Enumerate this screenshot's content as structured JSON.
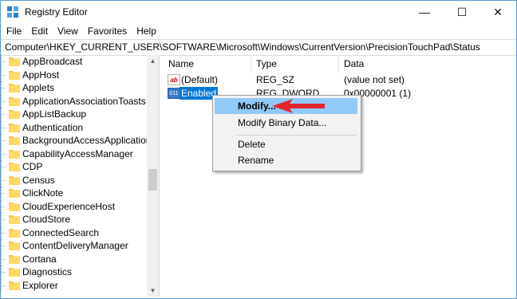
{
  "window": {
    "title": "Registry Editor",
    "controls": {
      "minimize": "—",
      "maximize": "☐",
      "close": "✕"
    }
  },
  "menubar": [
    "File",
    "Edit",
    "View",
    "Favorites",
    "Help"
  ],
  "address": "Computer\\HKEY_CURRENT_USER\\SOFTWARE\\Microsoft\\Windows\\CurrentVersion\\PrecisionTouchPad\\Status",
  "tree": {
    "items": [
      "AppBroadcast",
      "AppHost",
      "Applets",
      "ApplicationAssociationToasts",
      "AppListBackup",
      "Authentication",
      "BackgroundAccessApplications",
      "CapabilityAccessManager",
      "CDP",
      "Census",
      "ClickNote",
      "CloudExperienceHost",
      "CloudStore",
      "ConnectedSearch",
      "ContentDeliveryManager",
      "Cortana",
      "Diagnostics",
      "Explorer"
    ]
  },
  "values": {
    "columns": {
      "name": "Name",
      "type": "Type",
      "data": "Data"
    },
    "rows": [
      {
        "name": "(Default)",
        "type": "REG_SZ",
        "data": "(value not set)",
        "icon": "ab-string-icon"
      },
      {
        "name": "Enabled",
        "type": "REG_DWORD",
        "data": "0x00000001 (1)",
        "icon": "binary-dword-icon",
        "selected": true
      }
    ]
  },
  "context_menu": {
    "items": [
      "Modify...",
      "Modify Binary Data...",
      "Delete",
      "Rename"
    ],
    "highlighted": "Modify..."
  },
  "colors": {
    "accent": "#0078d7",
    "highlight": "#91c9f7",
    "arrow": "#e3262c",
    "folder": "#f4c64b"
  }
}
